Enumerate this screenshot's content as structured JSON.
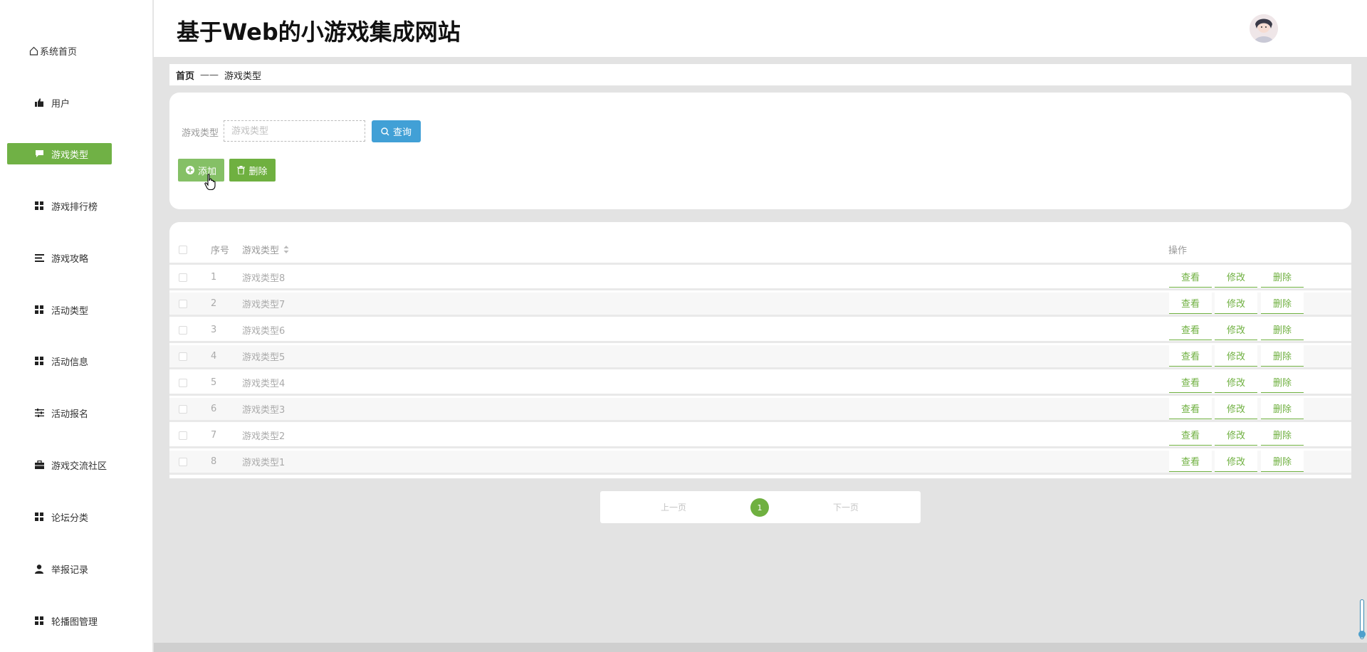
{
  "site": {
    "title": "基于Web的小游戏集成网站"
  },
  "sidebar": {
    "items": [
      {
        "label": "系统首页",
        "icon": "home-icon"
      },
      {
        "label": "用户",
        "icon": "thumb-icon"
      },
      {
        "label": "游戏类型",
        "icon": "chat-icon",
        "active": true
      },
      {
        "label": "游戏排行榜",
        "icon": "grid-icon"
      },
      {
        "label": "游戏攻略",
        "icon": "list-icon"
      },
      {
        "label": "活动类型",
        "icon": "grid-icon"
      },
      {
        "label": "活动信息",
        "icon": "grid-icon"
      },
      {
        "label": "活动报名",
        "icon": "sliders-icon"
      },
      {
        "label": "游戏交流社区",
        "icon": "briefcase-icon"
      },
      {
        "label": "论坛分类",
        "icon": "grid-icon"
      },
      {
        "label": "举报记录",
        "icon": "user-icon"
      },
      {
        "label": "轮播图管理",
        "icon": "grid-icon"
      }
    ]
  },
  "breadcrumb": {
    "home": "首页",
    "sep": "——",
    "current": "游戏类型"
  },
  "search": {
    "label": "游戏类型",
    "placeholder": "游戏类型",
    "query_label": "查询",
    "add_label": "添加",
    "delete_label": "删除"
  },
  "table": {
    "headers": {
      "index": "序号",
      "name": "游戏类型",
      "ops": "操作"
    },
    "rows": [
      {
        "index": "1",
        "name": "游戏类型8"
      },
      {
        "index": "2",
        "name": "游戏类型7"
      },
      {
        "index": "3",
        "name": "游戏类型6"
      },
      {
        "index": "4",
        "name": "游戏类型5"
      },
      {
        "index": "5",
        "name": "游戏类型4"
      },
      {
        "index": "6",
        "name": "游戏类型3"
      },
      {
        "index": "7",
        "name": "游戏类型2"
      },
      {
        "index": "8",
        "name": "游戏类型1"
      }
    ],
    "actions": {
      "view": "查看",
      "edit": "修改",
      "delete": "删除"
    }
  },
  "pager": {
    "prev": "上一页",
    "current": "1",
    "next": "下一页"
  },
  "colors": {
    "accent": "#70b145",
    "query": "#41a0d6"
  }
}
